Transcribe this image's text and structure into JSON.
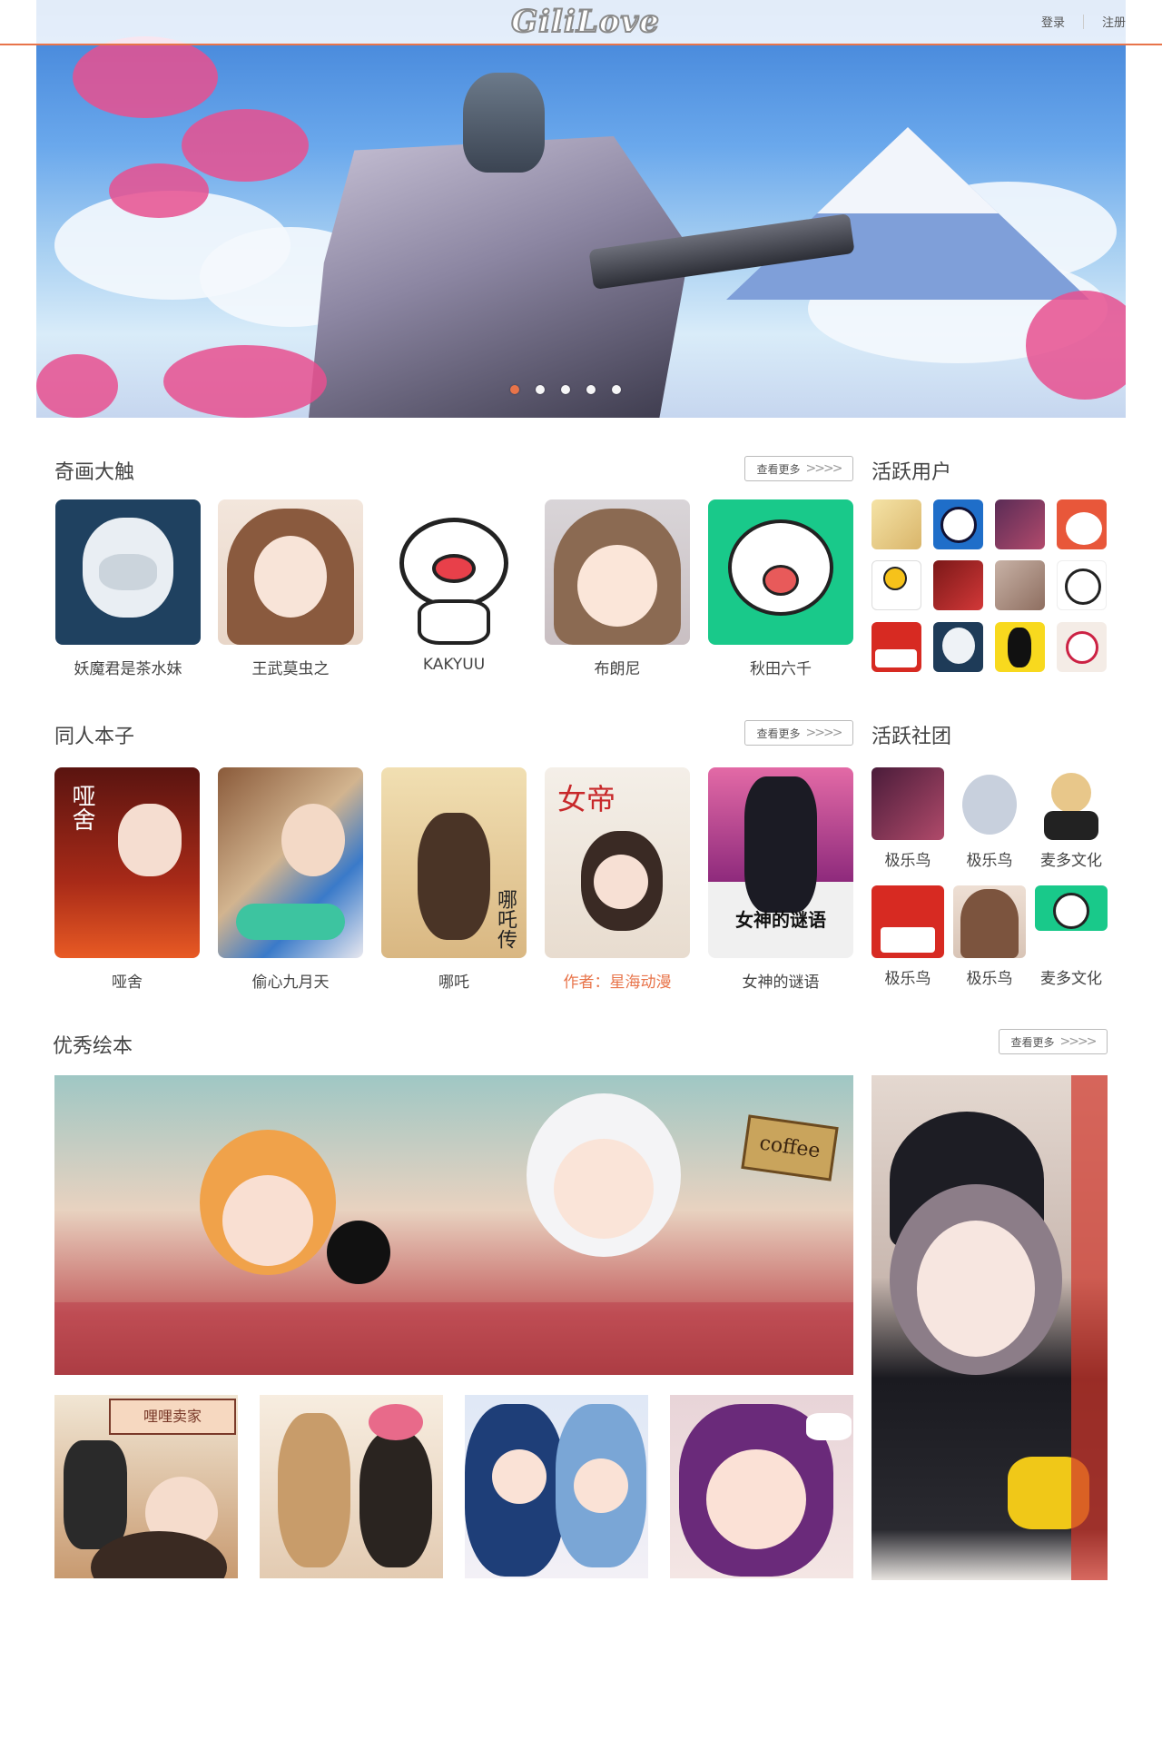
{
  "header": {
    "logo": "GiliLove",
    "login": "登录",
    "register": "注册"
  },
  "banner": {
    "slides": 5,
    "active_index": 0
  },
  "section_artists": {
    "title": "奇画大触",
    "more": "查看更多",
    "cards": [
      {
        "name": "妖魔君是茶水妹"
      },
      {
        "name": "王武莫虫之"
      },
      {
        "name": "KAKYUU"
      },
      {
        "name": "布朗尼"
      },
      {
        "name": "秋田六千"
      }
    ]
  },
  "section_active_users": {
    "title": "活跃用户"
  },
  "section_doujin": {
    "title": "同人本子",
    "more": "查看更多",
    "cards": [
      {
        "name": "哑舍",
        "cover_text": "哑舍"
      },
      {
        "name": "偷心九月天"
      },
      {
        "name": "哪吒",
        "cover_text": "哪吒传"
      },
      {
        "name": "作者：星海动漫",
        "cover_text": "女帝"
      },
      {
        "name": "女神的谜语",
        "cover_text": "女神的谜语"
      }
    ]
  },
  "section_clubs": {
    "title": "活跃社团",
    "clubs": [
      {
        "name": "极乐鸟"
      },
      {
        "name": "极乐鸟"
      },
      {
        "name": "麦多文化"
      },
      {
        "name": "极乐鸟"
      },
      {
        "name": "极乐鸟"
      },
      {
        "name": "麦多文化"
      }
    ]
  },
  "section_picturebooks": {
    "title": "优秀绘本",
    "more": "查看更多",
    "featured_sign": "coffee",
    "shop_sign": "哩哩卖家"
  },
  "icons": {
    "more": "chevrons-right-icon"
  },
  "colors": {
    "accent": "#e8744a",
    "header_line": "#e8744a"
  }
}
